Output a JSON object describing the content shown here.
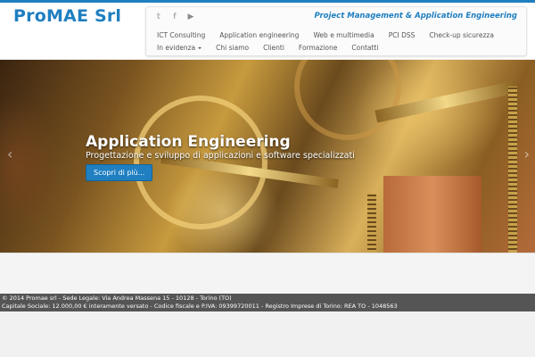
{
  "brand": {
    "logo": "ProMAE Srl",
    "color": "#1f7fc1"
  },
  "header": {
    "tagline": "Project Management & Application Engineering",
    "social": [
      {
        "icon": "twitter-icon",
        "glyph": "𝕥"
      },
      {
        "icon": "facebook-icon",
        "glyph": "f"
      },
      {
        "icon": "youtube-icon",
        "glyph": "▶"
      }
    ]
  },
  "nav": {
    "row1": [
      "ICT Consulting",
      "Application engineering",
      "Web e multimedia",
      "PCI DSS",
      "Check-up sicurezza"
    ],
    "row2": [
      "In evidenza",
      "Chi siamo",
      "Clienti",
      "Formazione",
      "Contatti"
    ]
  },
  "hero": {
    "title": "Application Engineering",
    "subtitle": "Progettazione e sviluppo di applicazioni e software specializzati",
    "button": "Scopri di più...",
    "prev": "‹",
    "next": "›"
  },
  "footer": {
    "line1": "© 2014 Promae srl - Sede Legale: Via Andrea Massena 15 - 10128 - Torino (TO)",
    "line2": "Capitale Sociale: 12.000,00 € interamente versato - Codice fiscale e P.IVA: 09399720011 - Registro Imprese di Torino: REA TO - 1048563"
  }
}
